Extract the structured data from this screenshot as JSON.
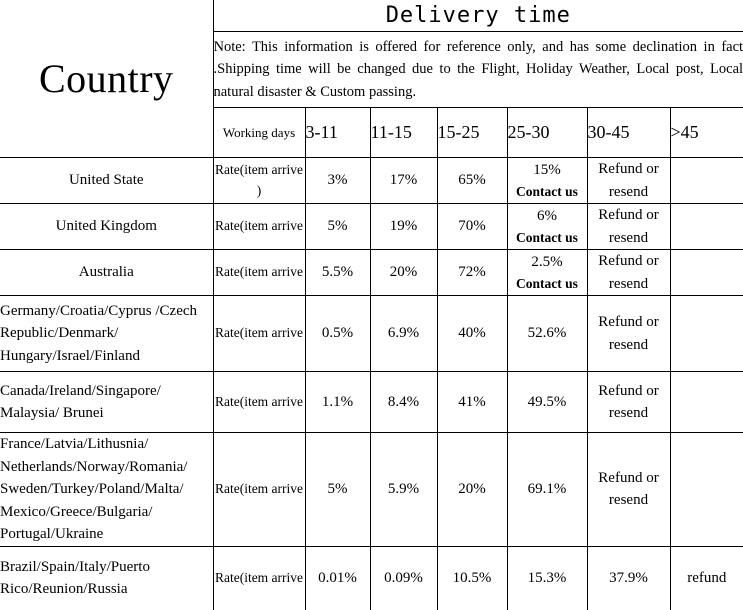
{
  "table": {
    "country_header": "Country",
    "delivery_title": "Delivery time",
    "note": "Note: This information is offered for reference only, and has some declination in fact .Shipping time will be changed due to the Flight, Holiday Weather, Local post, Local natural disaster & Custom passing.",
    "subheader": {
      "working_days": "Working days",
      "ranges": [
        "3-11",
        "11-15",
        "15-25",
        "25-30",
        "30-45",
        ">45"
      ]
    },
    "rows": [
      {
        "country": "United State",
        "country_align": "center",
        "rate": "Rate(item arrive )",
        "c1": "3%",
        "c2": "17%",
        "c3": "65%",
        "c4": "15%",
        "c4_note": "Contact us",
        "c5": "Refund or resend",
        "c6": ""
      },
      {
        "country": "United Kingdom",
        "country_align": "center",
        "rate": "Rate(item arrive",
        "c1": "5%",
        "c2": "19%",
        "c3": "70%",
        "c4": "6%",
        "c4_note": "Contact us",
        "c5": "Refund or resend",
        "c6": ""
      },
      {
        "country": "Australia",
        "country_align": "center",
        "rate": "Rate(item arrive",
        "c1": "5.5%",
        "c2": "20%",
        "c3": "72%",
        "c4": "2.5%",
        "c4_note": "Contact us",
        "c5": "Refund or resend",
        "c6": ""
      },
      {
        "country": "Germany/Croatia/Cyprus /Czech Republic/Denmark/ Hungary/Israel/Finland",
        "country_align": "left",
        "rate": "Rate(item arrive",
        "c1": "0.5%",
        "c2": "6.9%",
        "c3": "40%",
        "c4": "52.6%",
        "c4_note": "",
        "c5": "Refund or resend",
        "c6": ""
      },
      {
        "country": "Canada/Ireland/Singapore/ Malaysia/ Brunei",
        "country_align": "left",
        "rate": "Rate(item arrive",
        "c1": "1.1%",
        "c2": "8.4%",
        "c3": "41%",
        "c4": "49.5%",
        "c4_note": "",
        "c5": "Refund or resend",
        "c6": ""
      },
      {
        "country": "France/Latvia/Lithusnia/ Netherlands/Norway/Romania/ Sweden/Turkey/Poland/Malta/ Mexico/Greece/Bulgaria/ Portugal/Ukraine",
        "country_align": "left",
        "rate": "Rate(item arrive",
        "c1": "5%",
        "c2": "5.9%",
        "c3": "20%",
        "c4": "69.1%",
        "c4_note": "",
        "c5": "Refund or resend",
        "c6": ""
      },
      {
        "country": "Brazil/Spain/Italy/Puerto Rico/Reunion/Russia",
        "country_align": "left",
        "rate": "Rate(item arrive",
        "c1": "0.01%",
        "c2": "0.09%",
        "c3": "10.5%",
        "c4": "15.3%",
        "c4_note": "",
        "c5": "37.9%",
        "c6": "refund"
      }
    ]
  }
}
